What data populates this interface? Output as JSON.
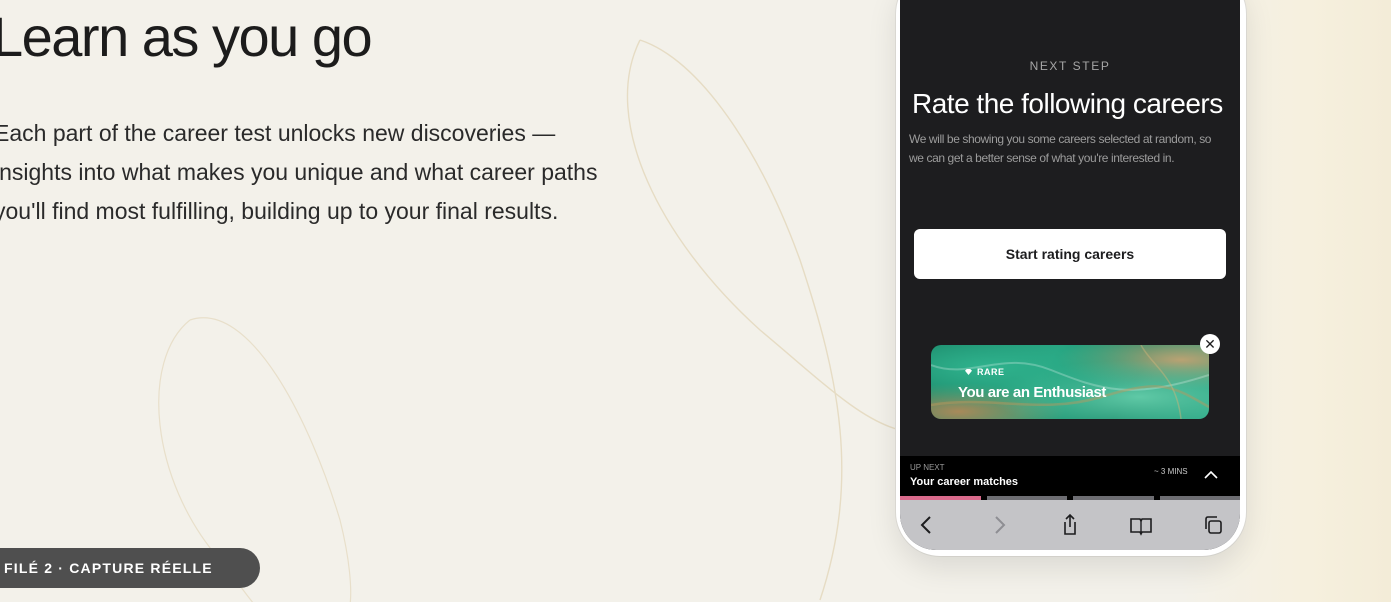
{
  "hero": {
    "headline": "Learn as you go",
    "body_lines": [
      "Each part of the career test unlocks new discoveries —",
      "insights into what makes you unique and what career paths",
      "you'll find most fulfilling, building up to your final results."
    ]
  },
  "phone": {
    "eyebrow": "NEXT STEP",
    "title": "Rate the following careers",
    "description": "We will be showing you some careers selected at random, so we can get a better sense of what you're interested in.",
    "primary_button": "Start rating careers",
    "badge": {
      "tag": "RARE",
      "title": "You are an Enthusiast",
      "icon": "gem-icon",
      "close_icon": "close-icon"
    },
    "up_next": {
      "label": "UP NEXT",
      "title": "Your career matches",
      "duration": "~ 3 MINS",
      "icon": "chevron-up-icon"
    },
    "progress": {
      "completed_steps": 1,
      "total_steps": 4,
      "active_color": "#d96a8c"
    },
    "browser_toolbar": {
      "icons": [
        "back-icon",
        "forward-icon",
        "share-icon",
        "bookmarks-icon",
        "tabs-icon"
      ]
    }
  },
  "caption": "FILÉ 2 · CAPTURE RÉELLE",
  "colors": {
    "background": "#f3f1ea",
    "screen": "#1d1d1f",
    "badge_green": "#1f9473",
    "caption_pill": "#4f4f4f"
  }
}
